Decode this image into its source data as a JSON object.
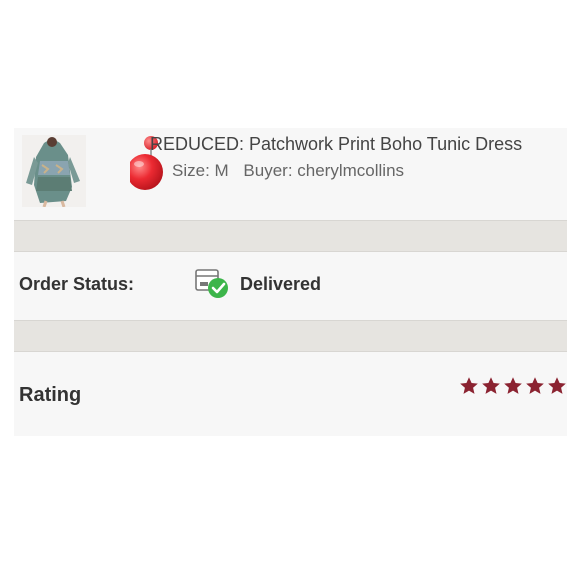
{
  "item": {
    "title": "REDUCED: Patchwork Print Boho Tunic Dress",
    "size": "Size: M",
    "buyer": "Buyer: cherylmcollins",
    "thumbnail": "dress-thumbnail"
  },
  "order_status": {
    "label": "Order Status:",
    "value": "Delivered",
    "icon": "package-delivered-icon"
  },
  "rating": {
    "label": "Rating",
    "stars": 5,
    "max_stars": 5,
    "star_color": "#8b2331"
  },
  "colors": {
    "accent_red": "#e8303a",
    "success_green": "#3cb54a",
    "divider": "#e6e4e0"
  }
}
